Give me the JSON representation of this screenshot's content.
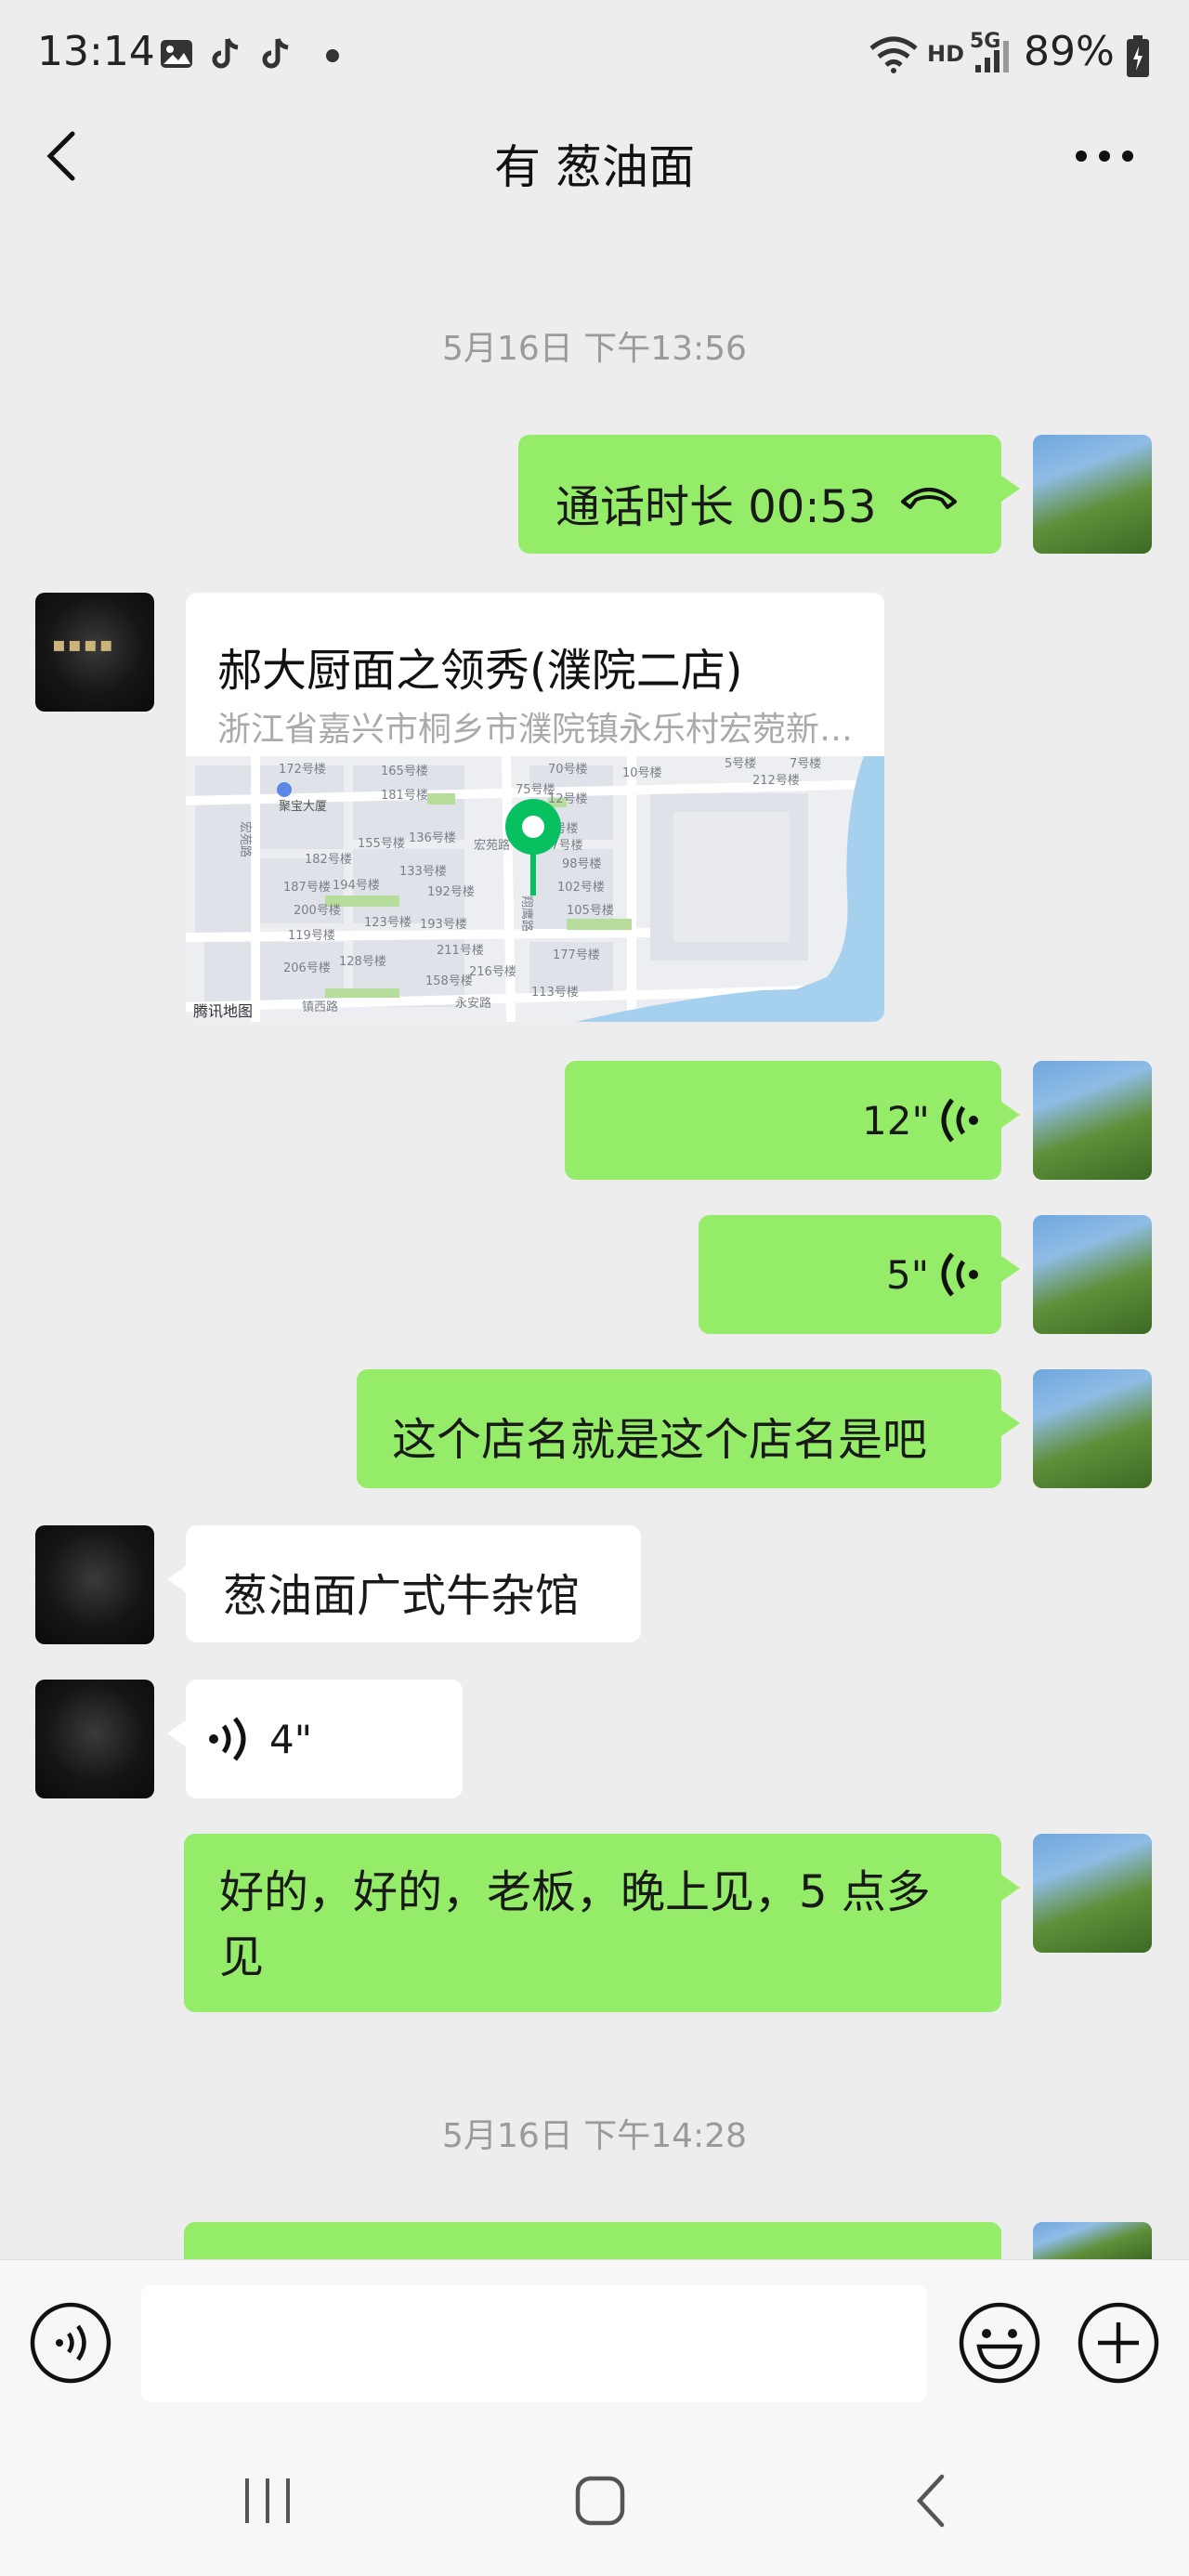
{
  "status_bar": {
    "time": "13:14",
    "battery": "89%",
    "network_labels": [
      "HD",
      "5G"
    ]
  },
  "header": {
    "title": "有 葱油面",
    "back_icon": "back-chevron-icon",
    "more_icon": "more-dots-icon"
  },
  "messages": [
    {
      "type": "timestamp",
      "text": "5月16日 下午13:56"
    },
    {
      "type": "call",
      "side": "me",
      "text": "通话时长 00:53",
      "icon": "phone-hangup-icon"
    },
    {
      "type": "location",
      "side": "other",
      "name": "郝大厨面之领秀(濮院二店)",
      "address": "浙江省嘉兴市桐乡市濮院镇永乐村宏菀新…",
      "map_credit": "腾讯地图"
    },
    {
      "type": "voice",
      "side": "me",
      "duration": "12\""
    },
    {
      "type": "voice",
      "side": "me",
      "duration": "5\""
    },
    {
      "type": "text",
      "side": "me",
      "text": "这个店名就是这个店名是吧"
    },
    {
      "type": "text",
      "side": "other",
      "text": "葱油面广式牛杂馆"
    },
    {
      "type": "voice",
      "side": "other",
      "duration": "4\""
    },
    {
      "type": "text",
      "side": "me",
      "text": "好的，好的，老板，晚上见，5 点多见"
    },
    {
      "type": "timestamp",
      "text": "5月16日 下午14:28"
    }
  ],
  "map_labels": [
    "聚宝大厦",
    "宏苑路",
    "172号楼",
    "181号楼",
    "165号楼",
    "75号楼",
    "70号楼",
    "10号楼",
    "5号楼",
    "7号楼",
    "212号楼",
    "78号楼",
    "12号楼",
    "87号楼",
    "98号楼",
    "102号楼",
    "105号楼",
    "178号楼",
    "182号楼",
    "155号楼",
    "136号楼",
    "133号楼",
    "192号楼",
    "187号楼",
    "194号楼",
    "200号楼",
    "123号楼",
    "193号楼",
    "119号楼",
    "211号楼",
    "206号楼",
    "128号楼",
    "158号楼",
    "216号楼",
    "177号楼",
    "113号楼",
    "永安路",
    "镇西路",
    "翔鹰路"
  ],
  "input_bar": {
    "voice_icon": "voice-input-icon",
    "emoji_icon": "emoji-icon",
    "plus_icon": "plus-icon"
  },
  "colors": {
    "my_bubble": "#95ec69",
    "their_bubble": "#ffffff",
    "background": "#ededed",
    "map_pin": "#07c160"
  }
}
